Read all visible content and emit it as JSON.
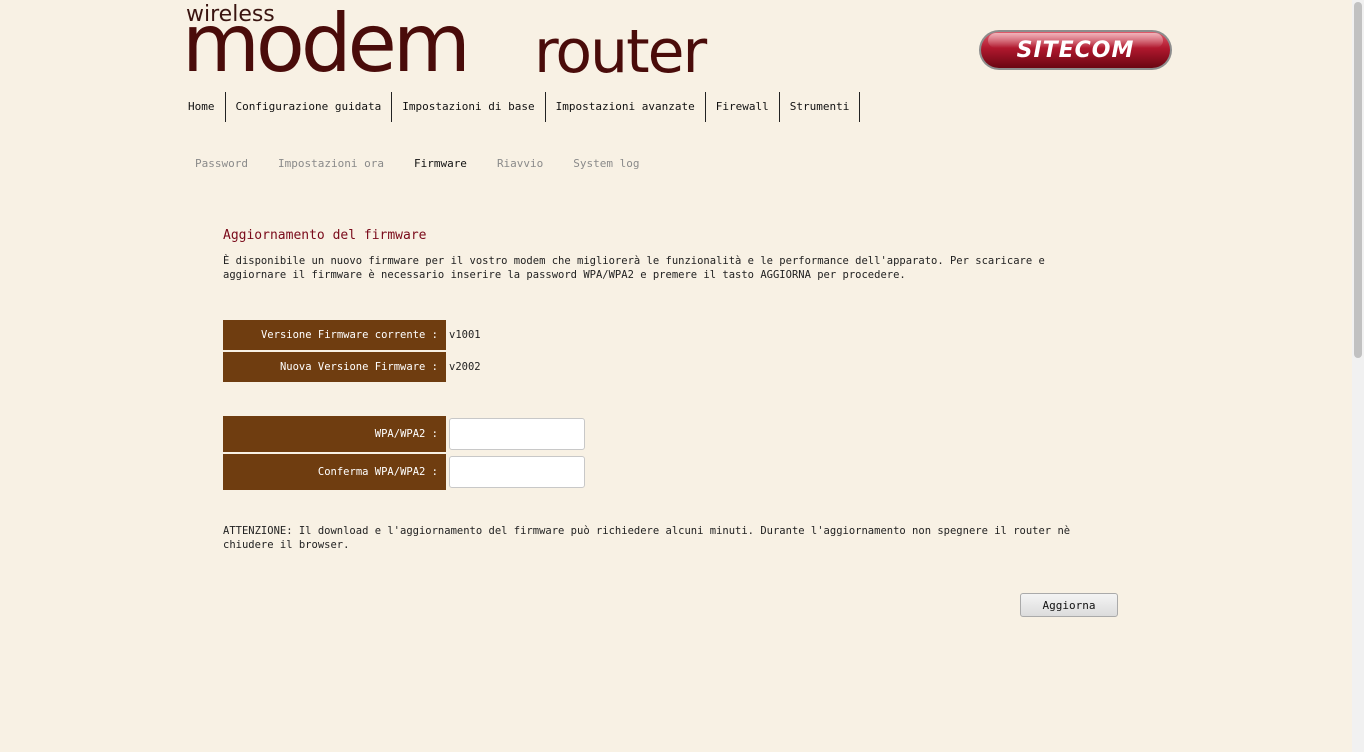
{
  "header": {
    "logo_wireless": "wireless",
    "logo_modem": "modem",
    "logo_router": "router",
    "brand": "SITECOM"
  },
  "mainnav": [
    {
      "label": "Home"
    },
    {
      "label": "Configurazione guidata"
    },
    {
      "label": "Impostazioni di base"
    },
    {
      "label": "Impostazioni avanzate"
    },
    {
      "label": "Firewall"
    },
    {
      "label": "Strumenti"
    }
  ],
  "subnav": [
    {
      "label": "Password"
    },
    {
      "label": "Impostazioni ora"
    },
    {
      "label": "Firmware",
      "active": true
    },
    {
      "label": "Riavvio"
    },
    {
      "label": "System log"
    }
  ],
  "content": {
    "title": "Aggiornamento del firmware",
    "intro": "È disponibile un nuovo firmware per il vostro modem che migliorerà le funzionalità e le performance dell'apparato. Per scaricare e aggiornare il firmware è necessario inserire la password WPA/WPA2 e premere il tasto AGGIORNA per procedere.",
    "current_fw_label": "Versione Firmware corrente :",
    "current_fw_value": "v1001",
    "new_fw_label": "Nuova Versione Firmware :",
    "new_fw_value": "v2002",
    "wpa_label": "WPA/WPA2 :",
    "wpa_value": "",
    "confirm_wpa_label": "Conferma WPA/WPA2 :",
    "confirm_wpa_value": "",
    "warning": "ATTENZIONE: Il download e l'aggiornamento del firmware può richiedere alcuni minuti. Durante l'aggiornamento non spegnere il router nè chiudere il browser.",
    "update_button": "Aggiorna"
  },
  "colors": {
    "background": "#f8f1e4",
    "label_bg": "#6f3d10",
    "title": "#7a0a1a",
    "logo": "#4a0c0a",
    "brand_red": "#a3162a"
  },
  "icons": {
    "brand_logo": "sitecom-logo"
  }
}
